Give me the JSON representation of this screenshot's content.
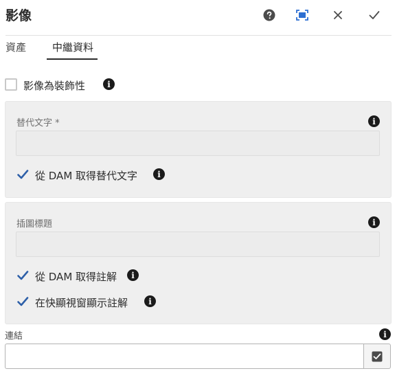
{
  "dialog": {
    "title": "影像",
    "header_buttons": [
      {
        "name": "help",
        "icon": "help-icon"
      },
      {
        "name": "fullscreen",
        "icon": "fullscreen-icon"
      },
      {
        "name": "cancel",
        "icon": "close-icon"
      },
      {
        "name": "done",
        "icon": "checkmark-icon"
      }
    ]
  },
  "tabs": [
    {
      "label": "資產",
      "active": false
    },
    {
      "label": "中繼資料",
      "active": true
    }
  ],
  "decorative": {
    "label": "影像為裝飾性",
    "checked": false
  },
  "alt_panel": {
    "field_label": "替代文字 *",
    "field_value": "",
    "from_dam": {
      "label": "從 DAM 取得替代文字",
      "checked": true
    }
  },
  "caption_panel": {
    "field_label": "插圖標題",
    "field_value": "",
    "from_dam": {
      "label": "從 DAM 取得註解",
      "checked": true
    },
    "popup": {
      "label": "在快顯視窗顯示註解",
      "checked": true
    }
  },
  "link": {
    "label": "連結",
    "value": ""
  },
  "colors": {
    "accent": "#1473e6",
    "check": "#2d5fa8",
    "panel_bg": "#efefef",
    "text": "#2c2c2c"
  }
}
